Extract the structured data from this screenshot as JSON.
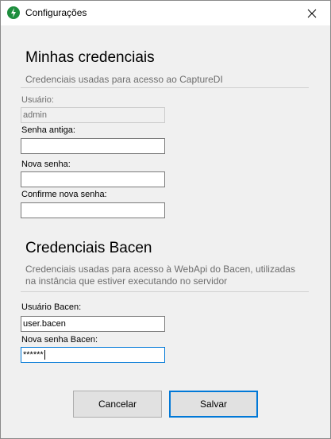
{
  "window": {
    "title": "Configurações",
    "icon": "capture-app-icon",
    "close_icon": "close-icon"
  },
  "my_credentials": {
    "title": "Minhas credenciais",
    "description": "Credenciais usadas para acesso ao CaptureDI",
    "user_label": "Usuário:",
    "user_value": "admin",
    "old_password_label": "Senha antiga:",
    "old_password_value": "",
    "new_password_label": "Nova senha:",
    "new_password_value": "",
    "confirm_password_label": "Confirme nova senha:",
    "confirm_password_value": ""
  },
  "bacen_credentials": {
    "title": "Credenciais Bacen",
    "description_line1": "Credenciais usadas para acesso à WebApi do Bacen, utilizadas",
    "description_line2": "na instância que estiver executando no servidor",
    "user_label": "Usuário Bacen:",
    "user_value": "user.bacen",
    "password_label": "Nova senha Bacen:",
    "password_value": "******"
  },
  "buttons": {
    "cancel": "Cancelar",
    "save": "Salvar"
  }
}
